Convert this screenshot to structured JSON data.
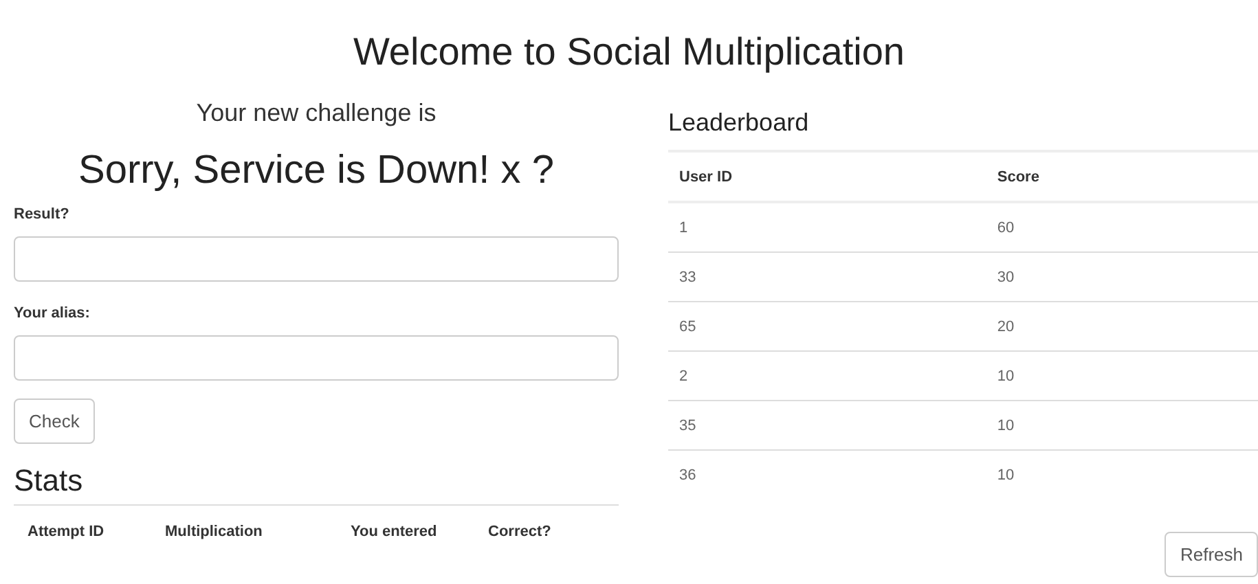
{
  "title": "Welcome to Social Multiplication",
  "challenge": {
    "intro": "Your new challenge is",
    "question": "Sorry, Service is Down! x ?"
  },
  "fields": [
    {
      "label": "Result?"
    },
    {
      "label": "Your alias:"
    }
  ],
  "check_button": "Check",
  "stats": {
    "heading": "Stats",
    "columns": [
      "Attempt ID",
      "Multiplication",
      "You entered",
      "Correct?"
    ]
  },
  "leaderboard": {
    "heading": "Leaderboard",
    "columns": [
      "User ID",
      "Score"
    ],
    "rows": [
      [
        "1",
        "60"
      ],
      [
        "33",
        "30"
      ],
      [
        "65",
        "20"
      ],
      [
        "2",
        "10"
      ],
      [
        "35",
        "10"
      ],
      [
        "36",
        "10"
      ]
    ]
  },
  "refresh_button": "Refresh"
}
